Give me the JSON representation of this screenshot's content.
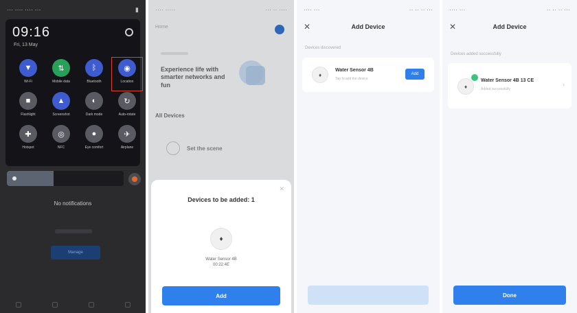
{
  "panel1": {
    "status_left": "··· ···· ···· ···",
    "status_right": "▮",
    "time": "09:16",
    "date": "Fri, 13 May",
    "tiles": [
      {
        "label": "Wi-Fi",
        "color": "#3f5bd0",
        "glyph": "▼",
        "icon": "wifi-icon"
      },
      {
        "label": "Mobile data",
        "color": "#28a05a",
        "glyph": "⇅",
        "icon": "mobile-data-icon"
      },
      {
        "label": "Bluetooth",
        "color": "#3f5bd0",
        "glyph": "ᛒ",
        "icon": "bluetooth-icon"
      },
      {
        "label": "Location",
        "color": "#3f5bd0",
        "glyph": "◉",
        "icon": "location-icon"
      },
      {
        "label": "Flashlight",
        "color": "#5a5a62",
        "glyph": "■",
        "icon": "flashlight-icon"
      },
      {
        "label": "Screenshot",
        "color": "#3f5bd0",
        "glyph": "▲",
        "icon": "screenshot-icon"
      },
      {
        "label": "Dark mode",
        "color": "#5a5a62",
        "glyph": "◐",
        "icon": "dark-mode-icon"
      },
      {
        "label": "Auto-rotate",
        "color": "#5a5a62",
        "glyph": "↻",
        "icon": "auto-rotate-icon"
      },
      {
        "label": "Hotspot",
        "color": "#5a5a62",
        "glyph": "✚",
        "icon": "hotspot-icon"
      },
      {
        "label": "NFC",
        "color": "#5a5a62",
        "glyph": "◎",
        "icon": "nfc-icon"
      },
      {
        "label": "Eye comfort",
        "color": "#5a5a62",
        "glyph": "●",
        "icon": "eye-comfort-icon"
      },
      {
        "label": "Airplane",
        "color": "#5a5a62",
        "glyph": "✈",
        "icon": "airplane-icon"
      }
    ],
    "no_notifications": "No notifications",
    "manage_label": "Manage"
  },
  "panel2": {
    "status_left": "···· ·····",
    "status_right": "··· ·· ····",
    "top_label": "Home",
    "banner": "Experience life with smarter networks and fun",
    "devices_title": "All Devices",
    "device_name": "Set the scene",
    "sheet_title": "Devices to be added: 1",
    "sheet_device_line1": "Water Sensor 4B",
    "sheet_device_line2": "00:22:4E",
    "sheet_button": "Add"
  },
  "panel3": {
    "status_left": "···· ···",
    "status_right": "·· ·· ·· ···",
    "title": "Add Device",
    "section": "Devices discovered",
    "device_name": "Water Sensor 4B",
    "device_sub": "Tap to add the device",
    "add_label": "Add",
    "bottom_button": ""
  },
  "panel4": {
    "status_left": "···· ···",
    "status_right": "·· ·· ·· ···",
    "title": "Add Device",
    "section": "Devices added successfully",
    "device_name": "Water Sensor 4B 13 CE",
    "device_sub": "Added successfully",
    "bottom_button": "Done"
  }
}
